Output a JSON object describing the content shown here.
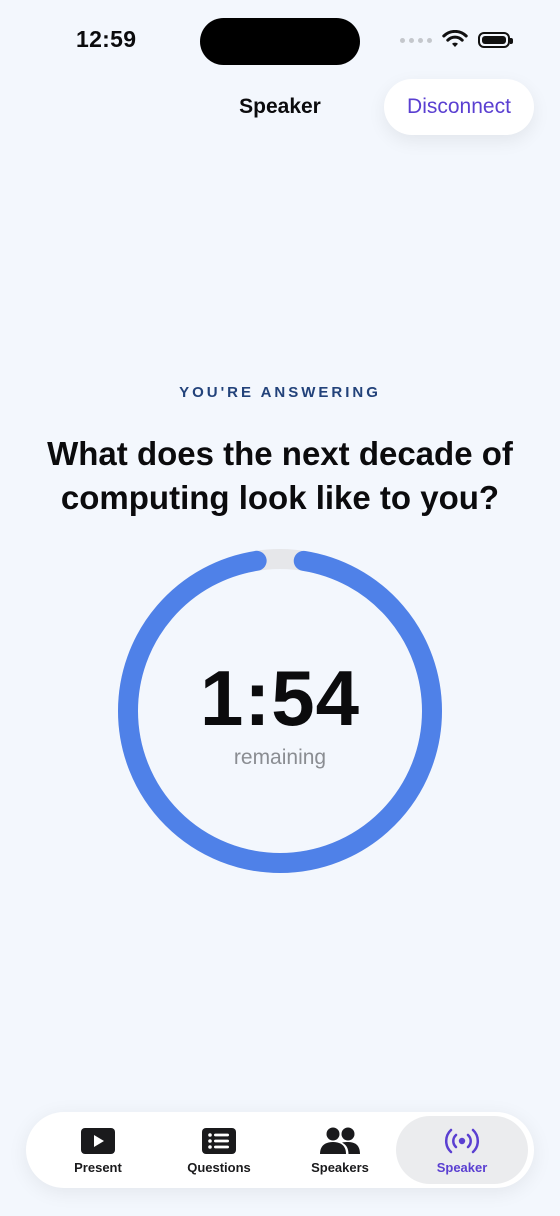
{
  "status_bar": {
    "time": "12:59"
  },
  "nav": {
    "title": "Speaker",
    "disconnect_label": "Disconnect"
  },
  "main": {
    "eyebrow": "YOU'RE ANSWERING",
    "question": "What does the next decade of computing look like to you?",
    "timer": {
      "value": "1:54",
      "label": "remaining",
      "progress_remaining": 0.95
    }
  },
  "tabs": [
    {
      "label": "Present",
      "icon": "play-icon",
      "active": false
    },
    {
      "label": "Questions",
      "icon": "list-icon",
      "active": false
    },
    {
      "label": "Speakers",
      "icon": "people-icon",
      "active": false
    },
    {
      "label": "Speaker",
      "icon": "broadcast-icon",
      "active": true
    }
  ],
  "colors": {
    "accent": "#5a3fd1",
    "ring": "#4f81e8",
    "ring_track": "#e6e7ea",
    "background": "#f3f7fd"
  }
}
